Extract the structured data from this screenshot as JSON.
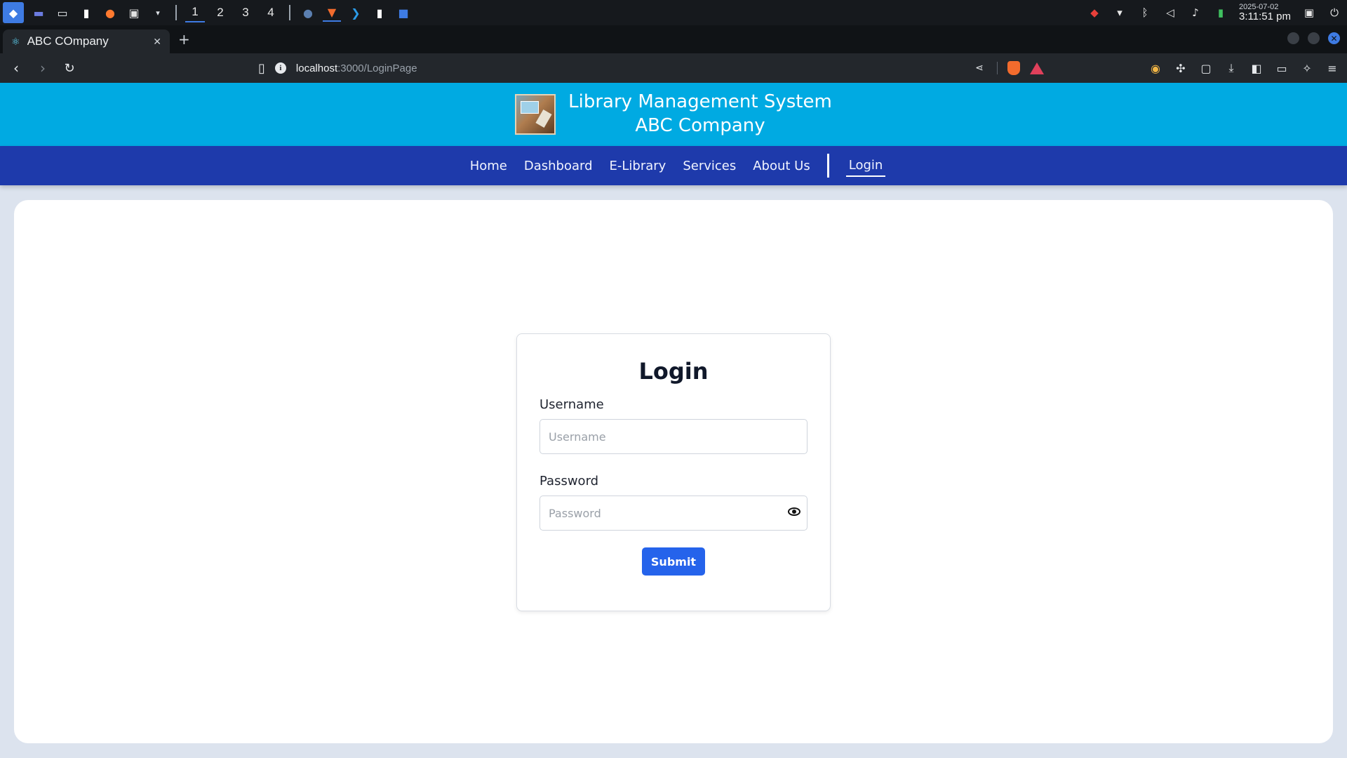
{
  "os": {
    "workspaces": [
      "1",
      "2",
      "3",
      "4"
    ],
    "active_workspace": "1",
    "clock_date": "2025-07-02",
    "clock_time": "3:11:51 pm",
    "tray_icons": [
      "anydesk-icon",
      "wifi-icon",
      "bluetooth-icon",
      "volume-muted-icon",
      "bell-icon",
      "battery-icon",
      "lock-icon",
      "power-icon"
    ]
  },
  "browser": {
    "tab_title": "ABC COmpany",
    "url_host": "localhost",
    "url_path": ":3000/LoginPage",
    "accent": "#3e7be3"
  },
  "site": {
    "title": "Library Management System",
    "subtitle": "ABC Company",
    "header_color": "#00aae2",
    "nav_color": "#1e3aab",
    "nav": [
      "Home",
      "Dashboard",
      "E-Library",
      "Services",
      "About Us"
    ],
    "nav_active": "Login"
  },
  "login": {
    "heading": "Login",
    "username_label": "Username",
    "username_placeholder": "Username",
    "password_label": "Password",
    "password_placeholder": "Password",
    "submit_label": "Submit",
    "button_color": "#2563eb"
  }
}
